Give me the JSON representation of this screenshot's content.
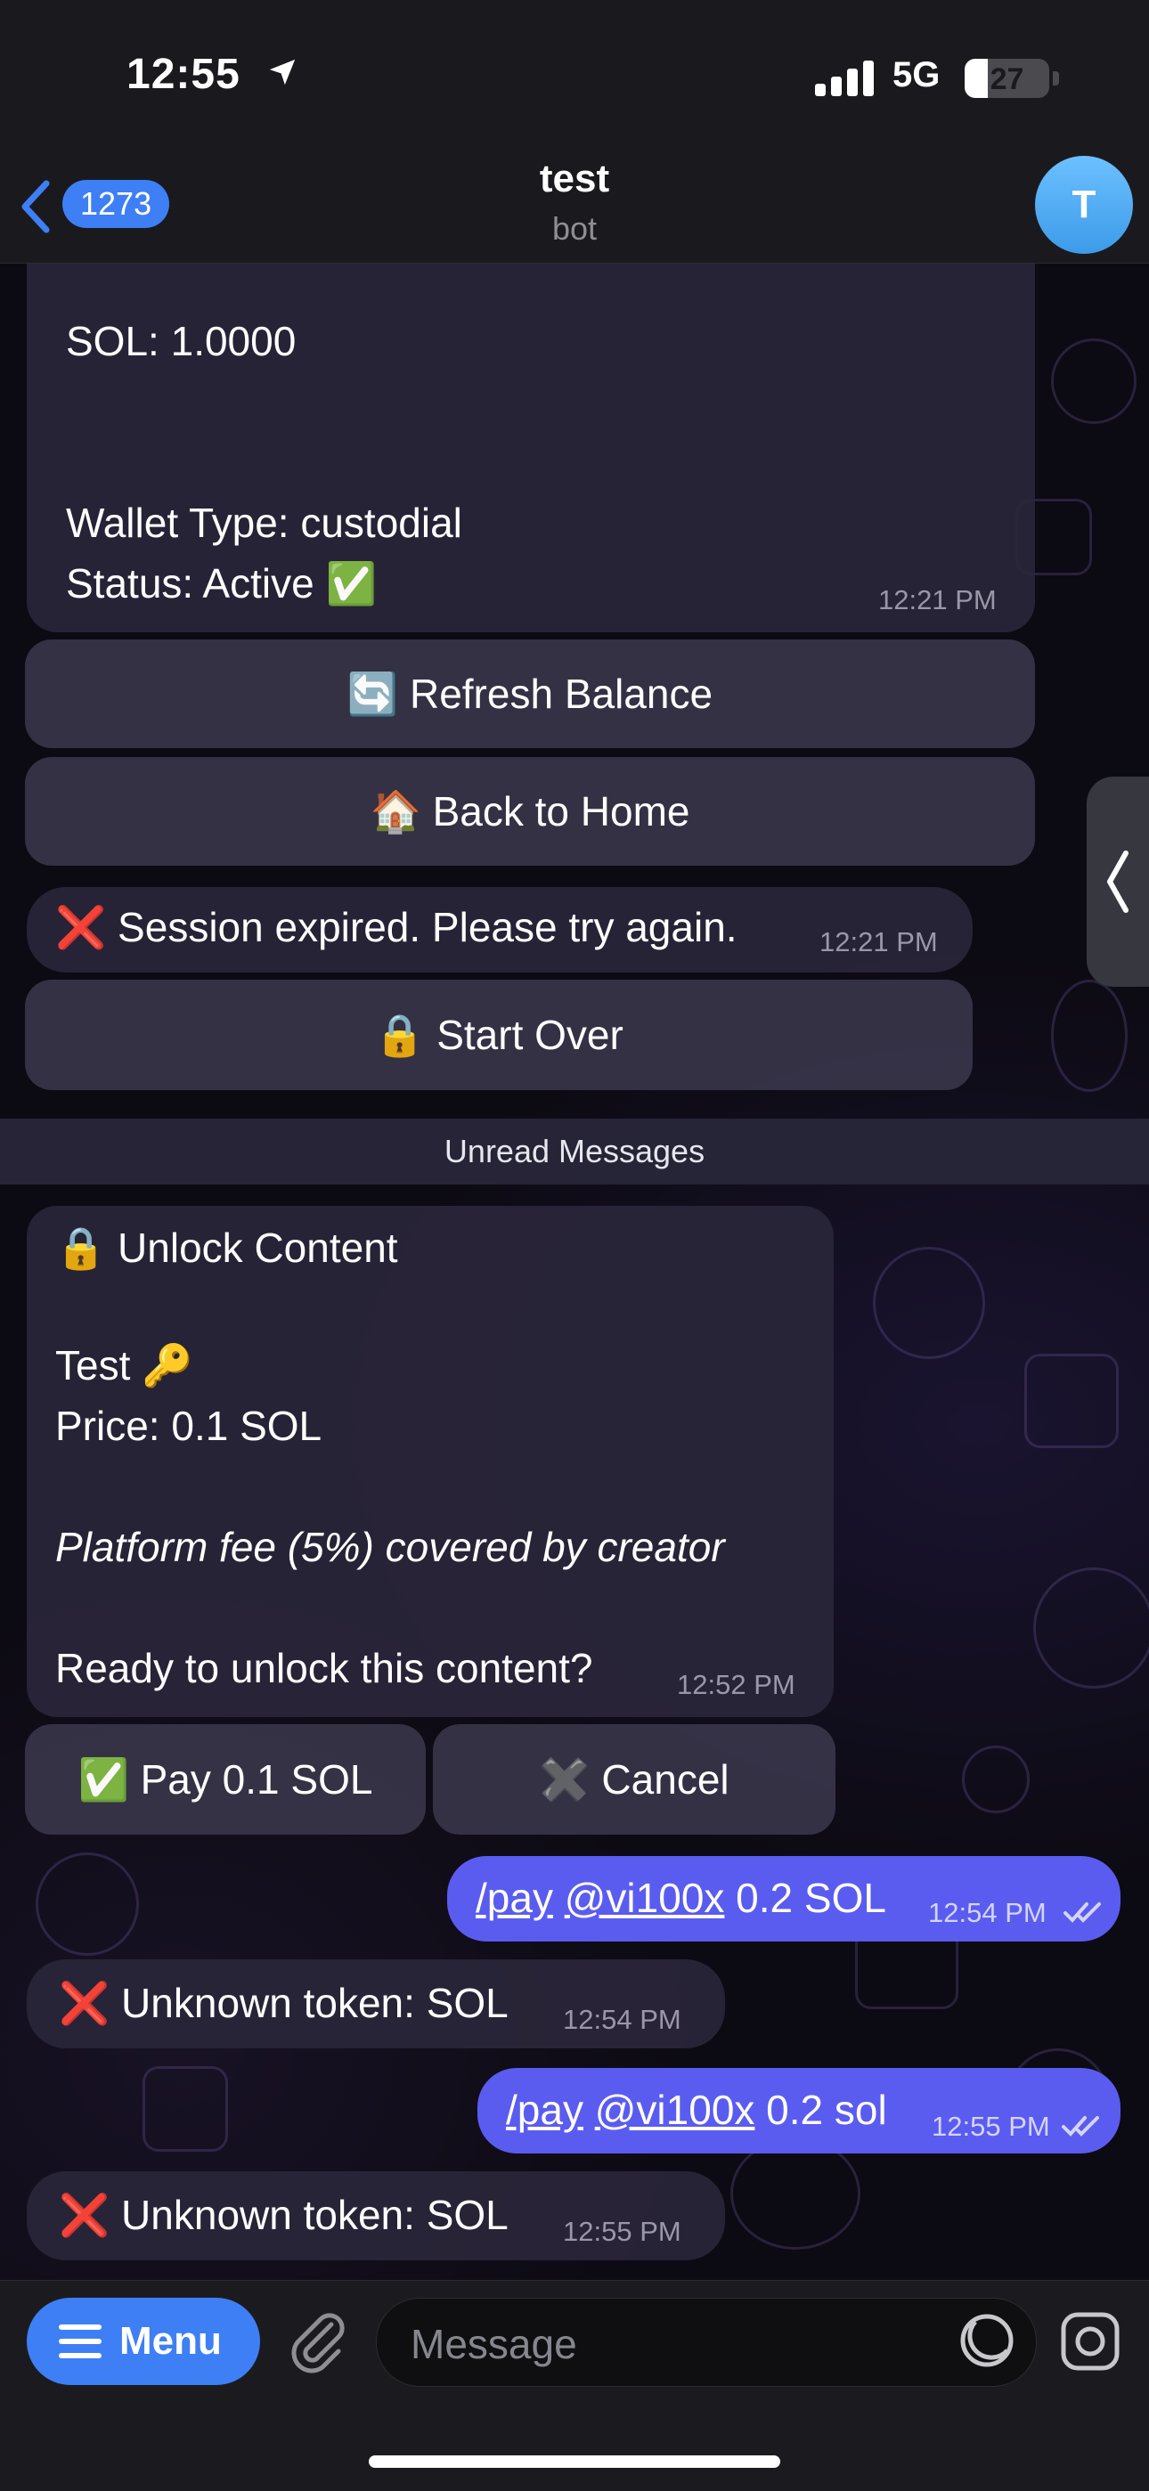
{
  "status": {
    "time": "12:55",
    "network": "5G",
    "battery": "27",
    "battery_level": 0.27
  },
  "header": {
    "unread_count": "1273",
    "title": "test",
    "subtitle": "bot",
    "avatar_initial": "T"
  },
  "messages": {
    "wallet": {
      "line1": "SOL: 1.0000",
      "line2": "Wallet Type: custodial",
      "line3": "Status: Active ✅",
      "time": "12:21 PM"
    },
    "wallet_buttons": {
      "refresh": "🔄 Refresh Balance",
      "home": "🏠 Back to Home"
    },
    "session": {
      "text": "❌ Session expired. Please try again.",
      "time": "12:21 PM",
      "button": "🔒 Start Over"
    },
    "unread_label": "Unread Messages",
    "unlock": {
      "title": "🔒 Unlock Content",
      "item": "Test 🔑",
      "price": "Price: 0.1 SOL",
      "fee": "Platform fee (5%) covered by creator",
      "question": "Ready to unlock this content?",
      "time": "12:52 PM"
    },
    "unlock_buttons": {
      "pay": "✅ Pay 0.1 SOL",
      "cancel": "✖️ Cancel"
    },
    "out1": {
      "cmd": "/pay",
      "mention": "@vi100x",
      "rest": " 0.2 SOL",
      "time": "12:54 PM"
    },
    "in1": {
      "text": "❌ Unknown token: SOL",
      "time": "12:54 PM"
    },
    "out2": {
      "cmd": "/pay",
      "mention": "@vi100x",
      "rest": " 0.2 sol",
      "time": "12:55 PM"
    },
    "in2": {
      "text": "❌ Unknown token: SOL",
      "time": "12:55 PM"
    }
  },
  "composer": {
    "menu_label": "Menu",
    "placeholder": "Message"
  },
  "colors": {
    "accent": "#3e7ff5",
    "outgoing": "#5a5cf0",
    "bubble": "#2a263a"
  }
}
